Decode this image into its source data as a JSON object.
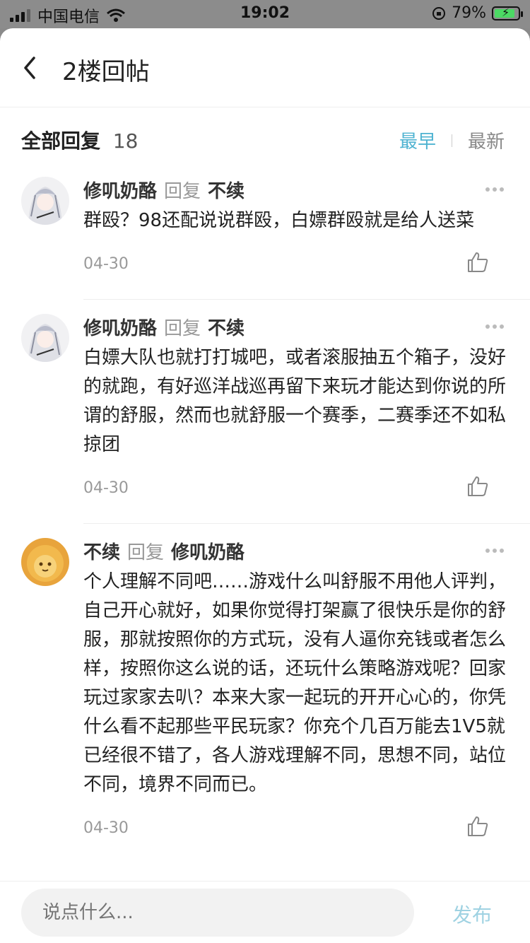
{
  "status": {
    "carrier": "中国电信",
    "time": "19:02",
    "battery": "79%",
    "battery_level": 79
  },
  "nav": {
    "title": "2楼回帖"
  },
  "replies": {
    "label": "全部回复",
    "count": "18",
    "sort_earliest": "最早",
    "sort_latest": "最新"
  },
  "posts": [
    {
      "author": "修叽奶酪",
      "verb": "回复",
      "target": "不续",
      "text": "群殴？98还配说说群殴，白嫖群殴就是给人送菜",
      "date": "04-30"
    },
    {
      "author": "修叽奶酪",
      "verb": "回复",
      "target": "不续",
      "text": "白嫖大队也就打打城吧，或者滚服抽五个箱子，没好的就跑，有好巡洋战巡再留下来玩才能达到你说的所谓的舒服，然而也就舒服一个赛季，二赛季还不如私掠团",
      "date": "04-30"
    },
    {
      "author": "不续",
      "verb": "回复",
      "target": "修叽奶酪",
      "text": "个人理解不同吧……游戏什么叫舒服不用他人评判，自己开心就好，如果你觉得打架赢了很快乐是你的舒服，那就按照你的方式玩，没有人逼你充钱或者怎么样，按照你这么说的话，还玩什么策略游戏呢？回家玩过家家去叭？本来大家一起玩的开开心心的，你凭什么看不起那些平民玩家？你充个几百万能去1V5就已经很不错了，各人游戏理解不同，思想不同，站位不同，境界不同而已。",
      "date": "04-30"
    }
  ],
  "composer": {
    "placeholder": "说点什么...",
    "publish_label": "发布"
  },
  "colors": {
    "accent": "#4fb3d1",
    "publish": "#9fd2e2"
  }
}
